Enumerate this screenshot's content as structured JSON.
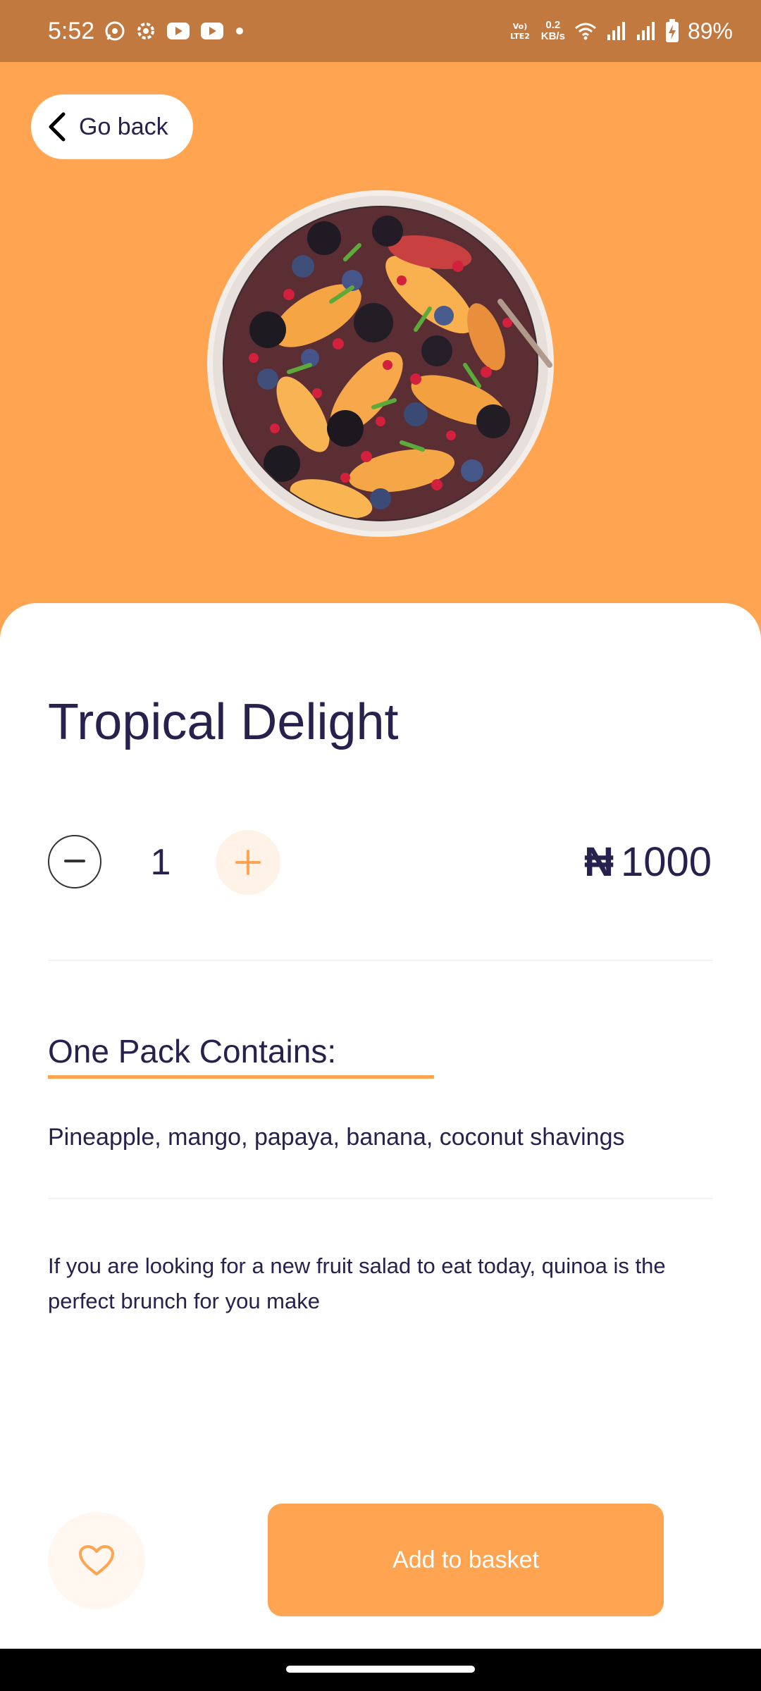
{
  "status_bar": {
    "time": "5:52",
    "net_top": "0.2",
    "net_bottom": "KB/s",
    "volte": "Vo)\nLTE2",
    "battery": "89%",
    "left_icons": [
      "whatsapp-icon",
      "settings-icon",
      "youtube-icon",
      "youtube-icon",
      "dot-icon"
    ],
    "right_icons": [
      "volte-icon",
      "wifi-icon",
      "signal-icon",
      "signal-icon",
      "battery-charging-icon"
    ]
  },
  "header": {
    "back_label": "Go back"
  },
  "product": {
    "title": "Tropical Delight",
    "quantity": "1",
    "currency_symbol": "₦",
    "price": "1000"
  },
  "contains": {
    "heading": "One Pack Contains:",
    "items": "Pineapple, mango, papaya, banana, coconut shavings"
  },
  "description": "If you are looking for a new fruit salad to eat today, quinoa is the perfect brunch for you make",
  "actions": {
    "add_to_basket": "Add to basket"
  },
  "colors": {
    "accent": "#FFA451",
    "status_bar": "#C1793F",
    "text_primary": "#27214D",
    "soft_accent": "#FFF2E7"
  }
}
